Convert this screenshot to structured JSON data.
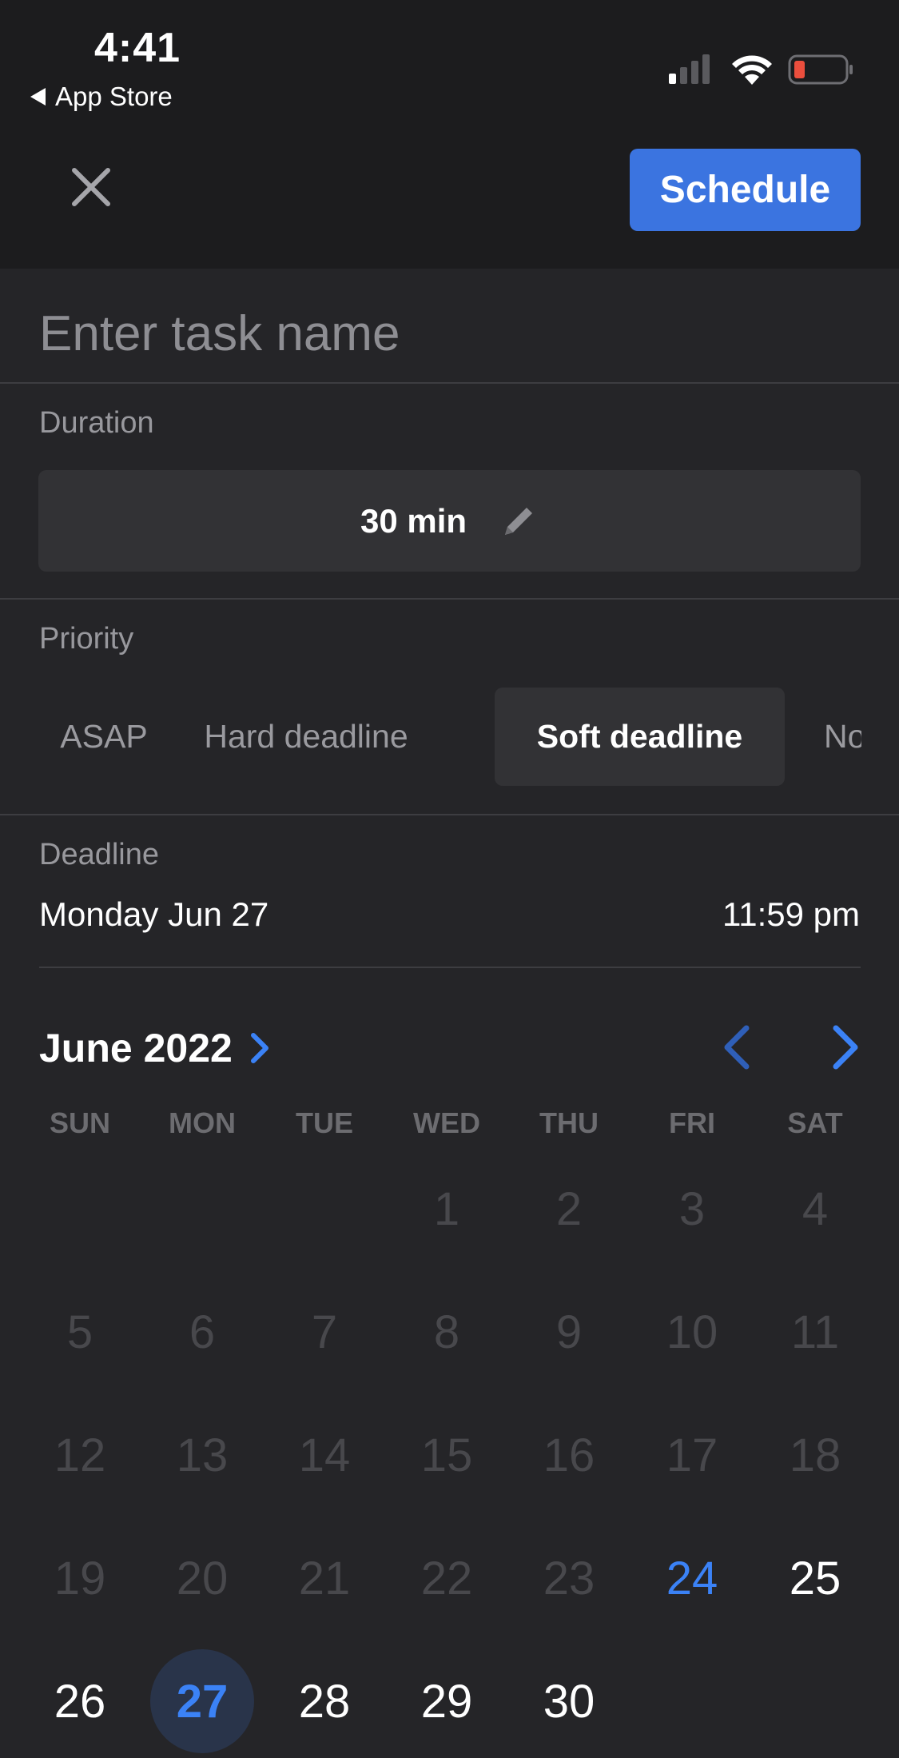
{
  "status_bar": {
    "time": "4:41",
    "back_label": "App Store",
    "battery_color": "#eb4e3d"
  },
  "header": {
    "close_icon": "close-icon",
    "schedule_label": "Schedule",
    "accent_color": "#3b74e0"
  },
  "task": {
    "name_value": "",
    "name_placeholder": "Enter task name"
  },
  "duration": {
    "label": "Duration",
    "value": "30 min",
    "edit_icon": "pencil-icon"
  },
  "priority": {
    "label": "Priority",
    "options": [
      "ASAP",
      "Hard deadline",
      "Soft deadline",
      "No"
    ],
    "selected": "Soft deadline"
  },
  "deadline": {
    "label": "Deadline",
    "date": "Monday Jun 27",
    "time": "11:59 pm"
  },
  "calendar": {
    "month_title": "June 2022",
    "weekdays": [
      "SUN",
      "MON",
      "TUE",
      "WED",
      "THU",
      "FRI",
      "SAT"
    ],
    "first_weekday_index": 3,
    "days_in_month": 30,
    "today": 24,
    "selected": 27,
    "first_available": 24
  }
}
